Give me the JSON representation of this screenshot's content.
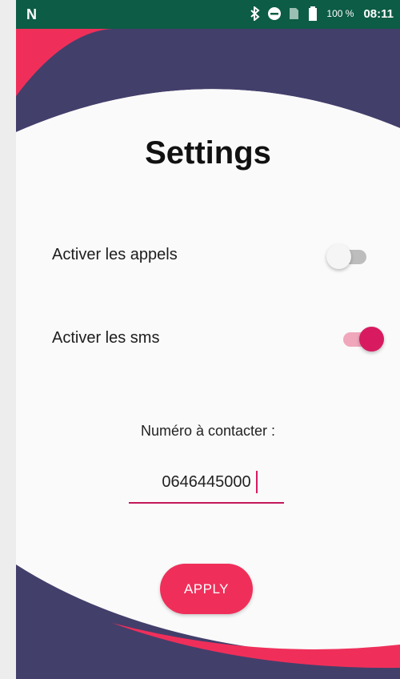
{
  "status_bar": {
    "left_icon": "n-logo-icon",
    "battery_percent": "100 %",
    "time": "08:11",
    "icons": [
      "bluetooth-icon",
      "do-not-disturb-icon",
      "no-sim-icon",
      "battery-icon"
    ]
  },
  "screen": {
    "title": "Settings",
    "calls": {
      "label": "Activer les appels",
      "enabled": false
    },
    "sms": {
      "label": "Activer les sms",
      "enabled": true
    },
    "number": {
      "label": "Numéro à contacter :",
      "value": "0646445000"
    },
    "apply_label": "APPLY"
  },
  "colors": {
    "status_bar": "#0d5c45",
    "accent_red": "#ef2f5a",
    "dark_navy": "#433f6b",
    "switch_on": "#d81b60"
  }
}
